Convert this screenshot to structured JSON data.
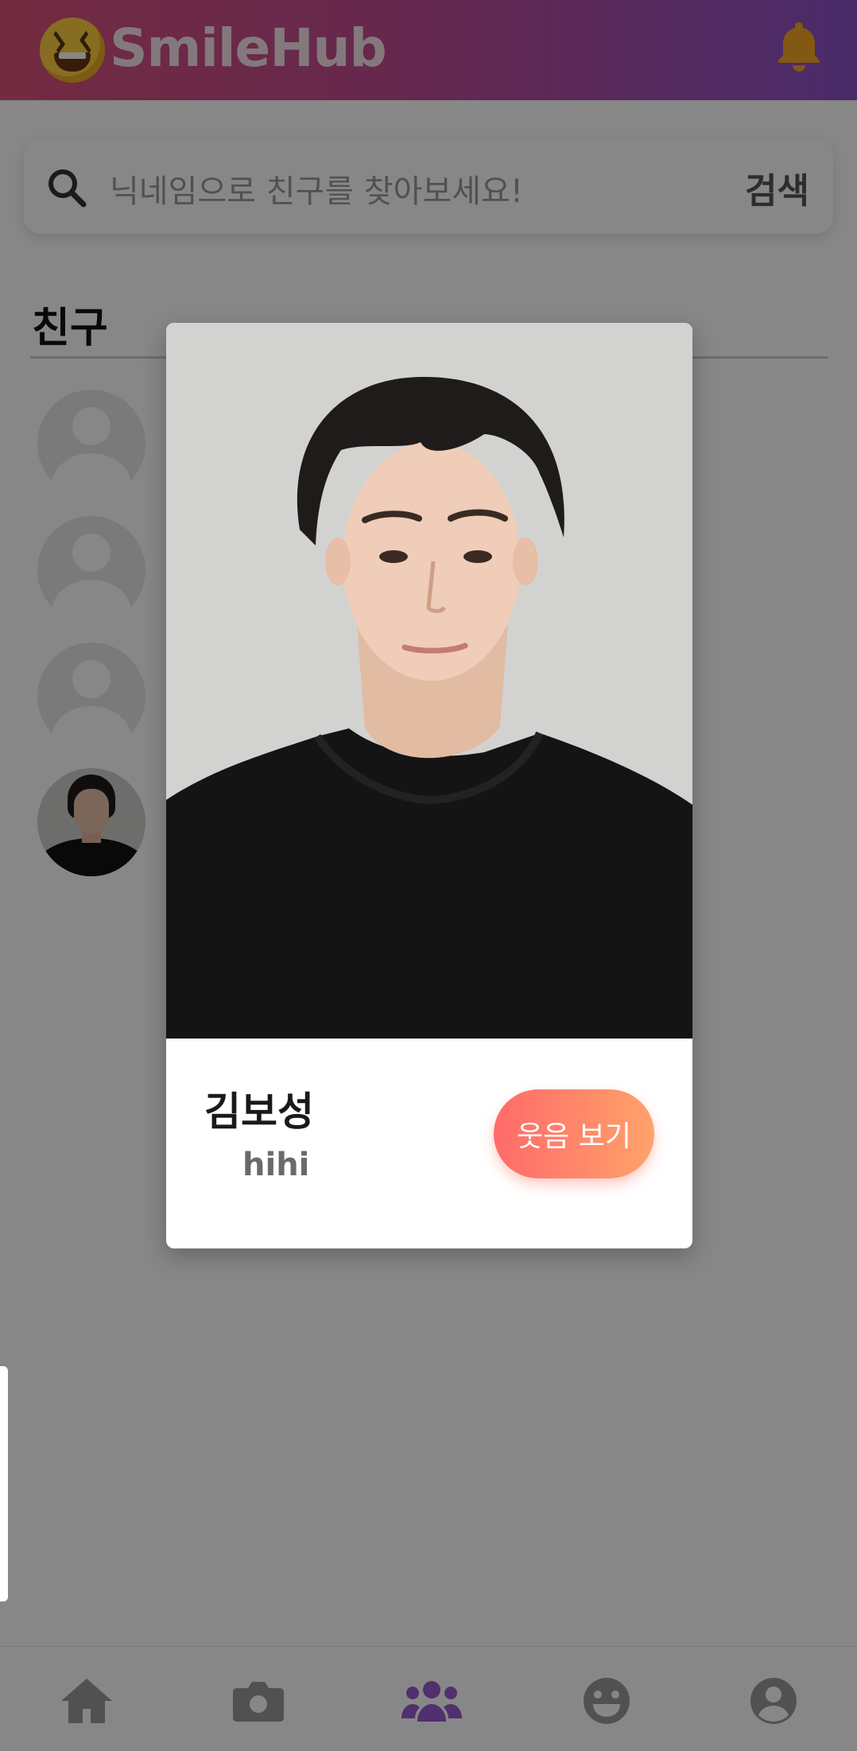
{
  "app": {
    "title": "SmileHub",
    "brand_gradient": [
      "#d9517a",
      "#8a52c8"
    ],
    "bell_color": "#f5a623"
  },
  "search": {
    "placeholder": "닉네임으로 친구를 찾아보세요!",
    "button_label": "검색"
  },
  "friends": {
    "section_title": "친구",
    "items": [
      {
        "avatar": "default-avatar-icon"
      },
      {
        "avatar": "default-avatar-icon"
      },
      {
        "avatar": "default-avatar-icon"
      },
      {
        "avatar": "photo"
      }
    ]
  },
  "modal": {
    "name": "김보성",
    "status": "hihi",
    "button_label": "웃음 보기",
    "button_gradient": [
      "#ff6a6a",
      "#ffa26a"
    ]
  },
  "bottom_nav": {
    "items": [
      {
        "icon": "home-icon",
        "active": false
      },
      {
        "icon": "camera-icon",
        "active": false
      },
      {
        "icon": "friends-icon",
        "active": true
      },
      {
        "icon": "smile-icon",
        "active": false
      },
      {
        "icon": "profile-icon",
        "active": false
      }
    ],
    "active_color": "#9b59d0",
    "inactive_color": "#9a9a9a"
  }
}
